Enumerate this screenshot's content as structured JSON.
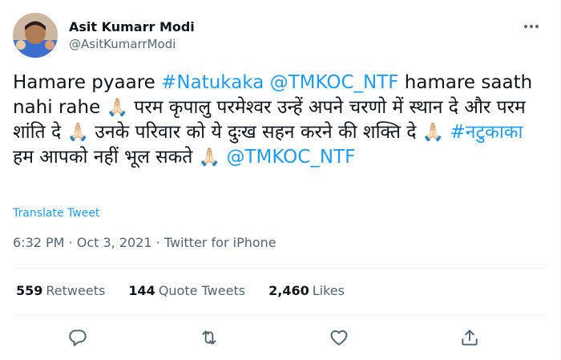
{
  "author": {
    "display_name": "Asit Kumarr Modi",
    "handle": "@AsitKumarrModi"
  },
  "more_icon": "more-horizontal-icon",
  "tweet": {
    "t1": "Hamare pyaare ",
    "hashtag1": "#Natukaka",
    "t2": " ",
    "mention1": "@TMKOC_NTF",
    "t3": " hamare saath nahi rahe ",
    "emoji1": "🙏🏻",
    "t4": " परम कृपालु परमेश्वर उन्हें अपने चरणो में स्थान दे और परम शांति दे ",
    "emoji2": "🙏🏻",
    "t5": " उनके परिवार को ये दुःख सहन करने की शक्ति दे ",
    "emoji3": "🙏🏻",
    "t6": " ",
    "hashtag2": "#नटुकाका",
    "t7": " हम आपको नहीं भूल सकते ",
    "emoji4": "🙏🏻",
    "t8": " ",
    "mention2": "@TMKOC_NTF"
  },
  "translate_label": "Translate Tweet",
  "meta": {
    "time": "6:32 PM",
    "sep1": " · ",
    "date": "Oct 3, 2021",
    "sep2": " · ",
    "source": "Twitter for iPhone"
  },
  "stats": {
    "retweets_count": "559",
    "retweets_label": "Retweets",
    "quotes_count": "144",
    "quotes_label": "Quote Tweets",
    "likes_count": "2,460",
    "likes_label": "Likes"
  },
  "colors": {
    "link": "#1d9bf0",
    "secondary_text": "#536471",
    "primary_text": "#0f1419",
    "divider": "#eff3f4"
  },
  "action_icons": [
    "reply-icon",
    "retweet-icon",
    "like-icon",
    "share-icon"
  ]
}
